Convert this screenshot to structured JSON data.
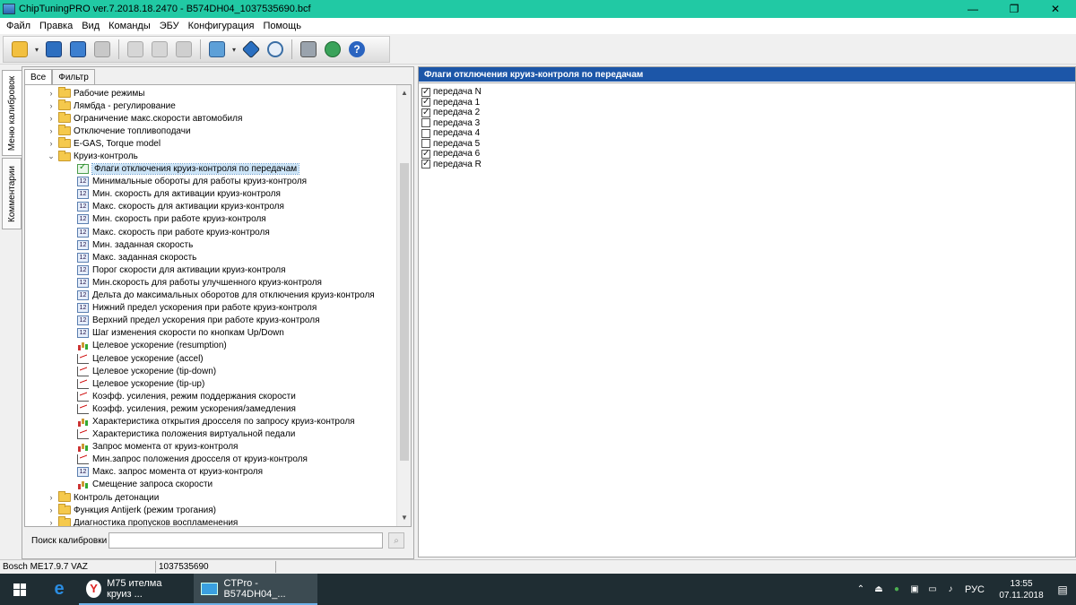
{
  "window": {
    "title": "ChipTuningPRO ver.7.2018.18.2470 - B574DH04_1037535690.bcf",
    "minimize": "—",
    "maximize": "❐",
    "close": "✕"
  },
  "menu": [
    "Файл",
    "Правка",
    "Вид",
    "Команды",
    "ЭБУ",
    "Конфигурация",
    "Помощь"
  ],
  "side_tabs": {
    "calibrations": "Меню калибровок",
    "comments": "Комментарии"
  },
  "filter_tabs": {
    "all": "Все",
    "filter": "Фильтр"
  },
  "tree": {
    "folders_top": [
      "Рабочие режимы",
      "Лямбда - регулирование",
      "Ограничение макс.скорости автомобиля",
      "Отключение топливоподачи",
      "E-GAS, Torque model",
      "Круиз-контроль"
    ],
    "cruise_items": [
      {
        "label": "Флаги отключения круиз-контроля по передачам",
        "icon": "flags-icon"
      },
      {
        "label": "Минимальные обороты для работы круиз-контроля",
        "icon": "scalar-icon"
      },
      {
        "label": "Мин. скорость для активации круиз-контроля",
        "icon": "scalar-icon"
      },
      {
        "label": "Макс. скорость для активации круиз-контроля",
        "icon": "scalar-icon"
      },
      {
        "label": "Мин. скорость при работе круиз-контроля",
        "icon": "scalar-icon"
      },
      {
        "label": "Макс. скорость при работе круиз-контроля",
        "icon": "scalar-icon"
      },
      {
        "label": "Мин. заданная скорость",
        "icon": "scalar-icon"
      },
      {
        "label": "Макс. заданная скорость",
        "icon": "scalar-icon"
      },
      {
        "label": "Порог скорости для активации круиз-контроля",
        "icon": "scalar-icon"
      },
      {
        "label": "Мин.скорость для работы улучшенного круиз-контроля",
        "icon": "scalar-icon"
      },
      {
        "label": "Дельта до максимальных оборотов для отключения круиз-контроля",
        "icon": "scalar-icon"
      },
      {
        "label": "Нижний предел ускорения при работе круиз-контроля",
        "icon": "scalar-icon"
      },
      {
        "label": "Верхний предел ускорения при работе круиз-контроля",
        "icon": "scalar-icon"
      },
      {
        "label": "Шаг изменения скорости по кнопкам Up/Down",
        "icon": "scalar-icon"
      },
      {
        "label": "Целевое ускорение (resumption)",
        "icon": "map3d-icon"
      },
      {
        "label": "Целевое ускорение (accel)",
        "icon": "curve2d-icon"
      },
      {
        "label": "Целевое ускорение (tip-down)",
        "icon": "curve2d-icon"
      },
      {
        "label": "Целевое ускорение (tip-up)",
        "icon": "curve2d-icon"
      },
      {
        "label": "Коэфф. усиления, режим поддержания скорости",
        "icon": "curve2d-icon"
      },
      {
        "label": "Коэфф. усиления, режим ускорения/замедления",
        "icon": "curve2d-icon"
      },
      {
        "label": "Характеристика открытия дросселя по запросу круиз-контроля",
        "icon": "map3d-icon"
      },
      {
        "label": "Характеристика положения виртуальной педали",
        "icon": "curve2d-icon"
      },
      {
        "label": "Запрос момента от круиз-контроля",
        "icon": "map3d-icon"
      },
      {
        "label": "Мин.запрос положения дросселя от круиз-контроля",
        "icon": "curve2d-icon"
      },
      {
        "label": "Макс. запрос момента от круиз-контроля",
        "icon": "scalar-icon"
      },
      {
        "label": "Смещение запроса скорости",
        "icon": "map3d-icon"
      }
    ],
    "folders_bottom": [
      "Контроль детонации",
      "Функция Antijerk (режим трогания)",
      "Диагностика пропусков воспламенения"
    ],
    "scalar_icon_text": "12"
  },
  "search": {
    "label": "Поиск калибровки",
    "value": ""
  },
  "right": {
    "title": "Флаги отключения круиз-контроля по передачам",
    "flags": [
      {
        "label": "передача N",
        "checked": true
      },
      {
        "label": "передача 1",
        "checked": true
      },
      {
        "label": "передача 2",
        "checked": true
      },
      {
        "label": "передача 3",
        "checked": false
      },
      {
        "label": "передача 4",
        "checked": false
      },
      {
        "label": "передача 5",
        "checked": false
      },
      {
        "label": "передача 6",
        "checked": true
      },
      {
        "label": "передача R",
        "checked": true
      }
    ]
  },
  "status": {
    "ecu": "Bosch ME17.9.7 VAZ",
    "id": "1037535690"
  },
  "taskbar": {
    "app1": "M75 ителма круиз ...",
    "app2": "CTPro - B574DH04_...",
    "lang": "РУС",
    "time": "13:55",
    "date": "07.11.2018"
  },
  "colors": {
    "titlebar": "#21c9a4",
    "panel_header": "#1c56a8",
    "taskbar": "#1f2d33"
  }
}
